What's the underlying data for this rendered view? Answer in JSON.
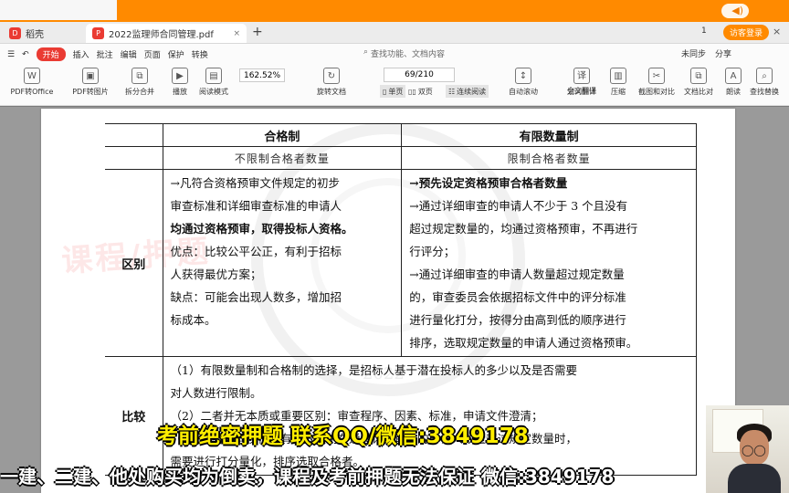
{
  "browser": {
    "home_tab_label": "稻壳",
    "active_tab_label": "2022监理师合同管理.pdf",
    "add_tab_label": "+",
    "tab_count": "1",
    "visitor_label": "访客登录",
    "window_controls": [
      "—",
      "□",
      "×"
    ]
  },
  "menu": {
    "items": [
      "开始",
      "插入",
      "批注",
      "编辑",
      "页面",
      "保护",
      "转换"
    ],
    "search_placeholder": "查找功能、文档内容",
    "right_items": [
      "未同步",
      "分享"
    ]
  },
  "toolbar": {
    "tools": [
      {
        "label": "PDF转Office",
        "icon": "file-convert-icon"
      },
      {
        "label": "PDF转图片",
        "icon": "image-convert-icon"
      },
      {
        "label": "拆分合并",
        "icon": "split-merge-icon"
      },
      {
        "label": "播放",
        "icon": "play-icon"
      },
      {
        "label": "阅读模式",
        "icon": "reading-mode-icon"
      },
      {
        "label": "旋转文档",
        "icon": "rotate-document-icon"
      },
      {
        "label": "自动滚动",
        "icon": "auto-scroll-icon"
      },
      {
        "label": "划词翻译",
        "icon": "translate-icon"
      },
      {
        "label": "全文翻译",
        "icon": "full-translate-icon"
      },
      {
        "label": "压缩",
        "icon": "compress-icon"
      },
      {
        "label": "截图和对比",
        "icon": "screenshot-icon"
      },
      {
        "label": "文档比对",
        "icon": "compare-icon"
      },
      {
        "label": "朗读",
        "icon": "read-aloud-icon"
      },
      {
        "label": "查找替换",
        "icon": "find-replace-icon"
      }
    ],
    "zoom": "162.52%",
    "page_indicator": "69/210",
    "view_single": "单页",
    "view_double": "双页",
    "view_continuous": "连续阅读"
  },
  "document": {
    "watermark": "课程/押题",
    "seal_year": "2022",
    "table": {
      "headers": [
        "合格制",
        "有限数量制"
      ],
      "subheaders": [
        "不限制合格者数量",
        "限制合格者数量"
      ],
      "rows": [
        {
          "label": "区别",
          "left": [
            {
              "text": "→凡符合资格预审文件规定的初步",
              "bold": false
            },
            {
              "text": "审查标准和详细审查标准的申请人",
              "bold": false
            },
            {
              "text": "均通过资格预审，取得投标人资格。",
              "bold": true
            },
            {
              "text": "",
              "bold": false
            },
            {
              "text": "优点：比较公平公正，有利于招标",
              "bold": false
            },
            {
              "text": "人获得最优方案；",
              "bold": false
            },
            {
              "text": "缺点：可能会出现人数多，增加招",
              "bold": false
            },
            {
              "text": "标成本。",
              "bold": false
            }
          ],
          "right": [
            {
              "text": "→预先设定资格预审合格者数量",
              "bold": true
            },
            {
              "text": "→通过详细审查的申请人不少于 3 个且没有",
              "bold": false
            },
            {
              "text": "超过规定数量的，均通过资格预审，不再进行",
              "bold": false
            },
            {
              "text": "行评分；",
              "bold": false
            },
            {
              "text": "→通过详细审查的申请人数量超过规定数量",
              "bold": false
            },
            {
              "text": "的，审查委员会依据招标文件中的评分标准",
              "bold": false
            },
            {
              "text": "进行量化打分，按得分由高到低的顺序进行",
              "bold": false
            },
            {
              "text": "排序，选取规定数量的申请人通过资格预审。",
              "bold": false
            }
          ]
        },
        {
          "label": "比较",
          "lines": [
            "（1）有限数量制和合格制的选择，是招标人基于潜在投标人的多少以及是否需要",
            "对人数进行限制。",
            "（2）二者并无本质或重要区别：审查程序、因素、标准，申请文件澄清；",
            "（3）二者不同仅在于有限数量制在通过详细审查的申请人数量超过规定数量时，",
            "需要进行打分量化，排序选取合格者。"
          ]
        }
      ]
    }
  },
  "overlays": {
    "promo_line_1": "考前绝密押题  联系QQ/微信:3849178",
    "promo_line_2": "一建、二建、他处购买均为倒卖，课程及考前押题无法保证 微信:3849178"
  }
}
